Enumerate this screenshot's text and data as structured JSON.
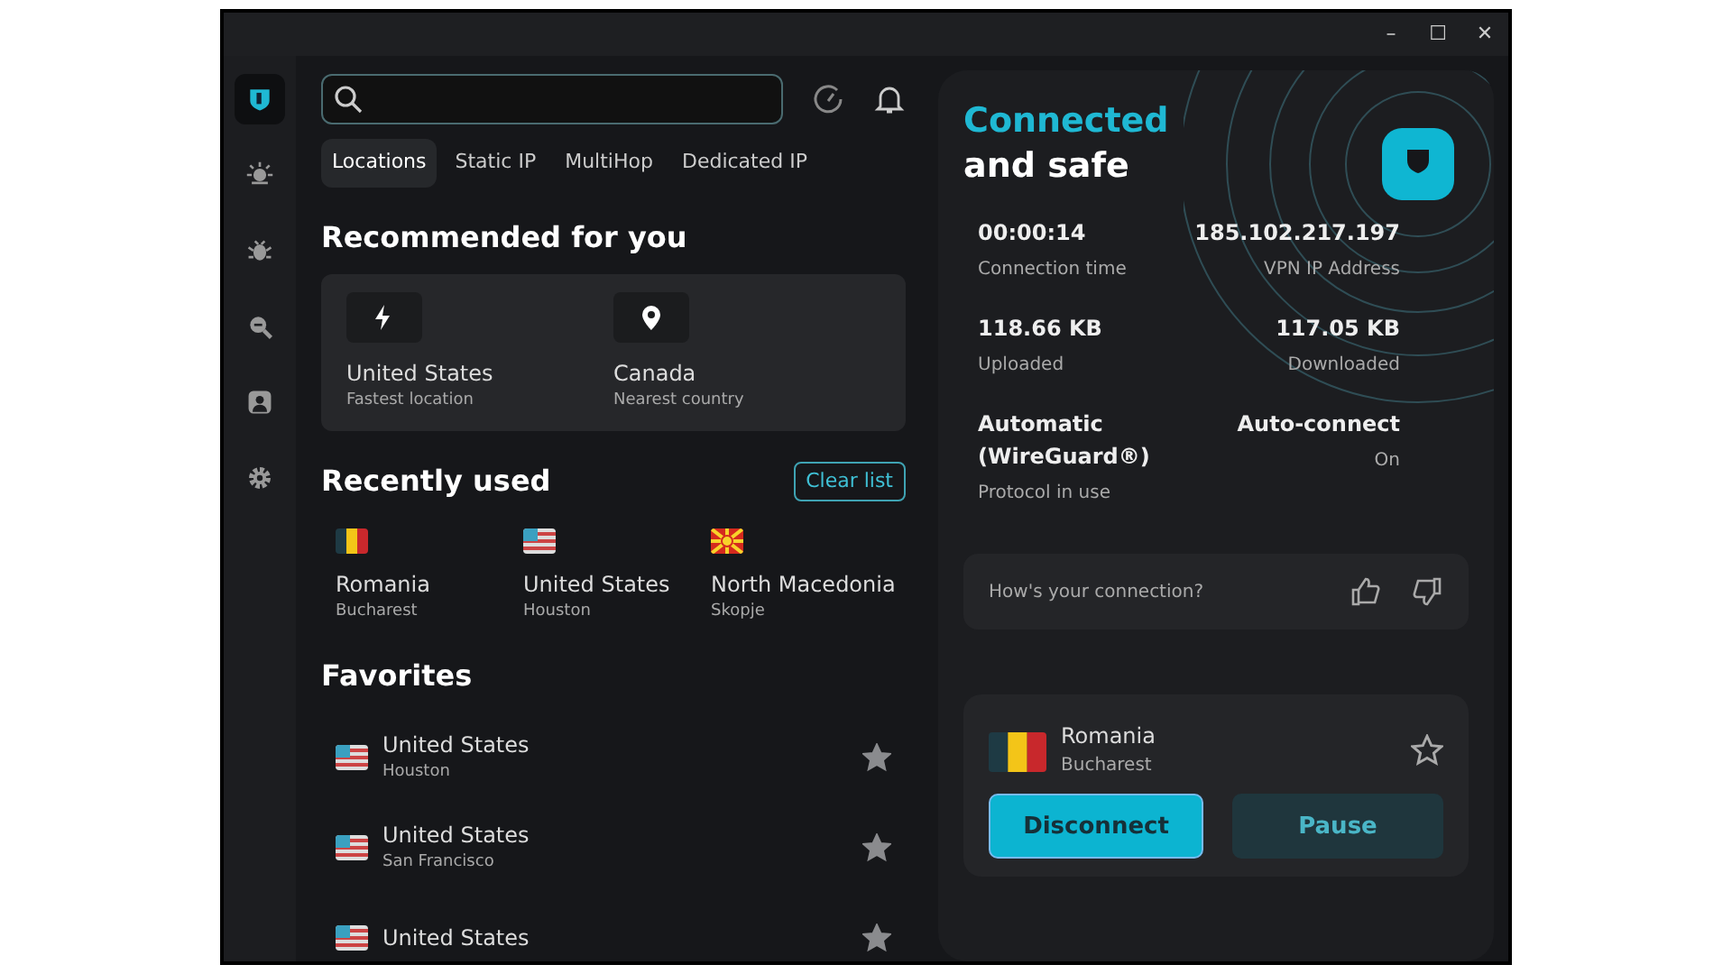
{
  "window": {
    "controls": [
      "–",
      "☐",
      "✕"
    ]
  },
  "sidebar": {
    "items": [
      {
        "kind": "shield",
        "selected": true
      },
      {
        "kind": "bulb",
        "selected": false
      },
      {
        "kind": "bug",
        "selected": false
      },
      {
        "kind": "zoom",
        "selected": false
      },
      {
        "kind": "person",
        "selected": false
      },
      {
        "kind": "gear",
        "selected": false
      }
    ]
  },
  "tabs": [
    {
      "label": "Locations",
      "selected": true
    },
    {
      "label": "Static IP",
      "selected": false
    },
    {
      "label": "MultiHop",
      "selected": false
    },
    {
      "label": "Dedicated IP",
      "selected": false
    }
  ],
  "recommended": {
    "title": "Recommended for you",
    "items": [
      {
        "kind": "bolt",
        "name": "United States",
        "sub": "Fastest location"
      },
      {
        "kind": "pin",
        "name": "Canada",
        "sub": "Nearest country"
      }
    ]
  },
  "recent": {
    "title": "Recently used",
    "clear_button": "Clear list",
    "items": [
      {
        "kind": "ro",
        "name": "Romania",
        "sub": "Bucharest"
      },
      {
        "kind": "us",
        "name": "United States",
        "sub": "Houston"
      },
      {
        "kind": "mk",
        "name": "North Macedonia",
        "sub": "Skopje"
      }
    ]
  },
  "favorites": {
    "title": "Favorites",
    "items": [
      {
        "kind": "us",
        "name": "United States",
        "sub": "Houston",
        "favorite": true
      },
      {
        "kind": "us",
        "name": "United States",
        "sub": "San Francisco",
        "favorite": true
      },
      {
        "kind": "us",
        "name": "United States",
        "favorite": true
      }
    ]
  },
  "status": {
    "line1": "Connected",
    "line2": "and safe"
  },
  "stats": [
    {
      "value": "00:00:14",
      "label": "Connection time"
    },
    {
      "value": "185.102.217.197",
      "label": "VPN IP Address"
    },
    {
      "value": "118.66 KB",
      "label": "Uploaded"
    },
    {
      "value": "117.05 KB",
      "label": "Downloaded"
    },
    {
      "value": "Automatic (WireGuard®)",
      "label": "Protocol in use"
    },
    {
      "value": "Auto-connect",
      "label": "On"
    }
  ],
  "feedback": {
    "question": "How's your connection?"
  },
  "current": {
    "kind": "ro",
    "name": "Romania",
    "sub": "Bucharest",
    "favorite": false,
    "buttons": [
      "Disconnect",
      "Pause"
    ]
  }
}
